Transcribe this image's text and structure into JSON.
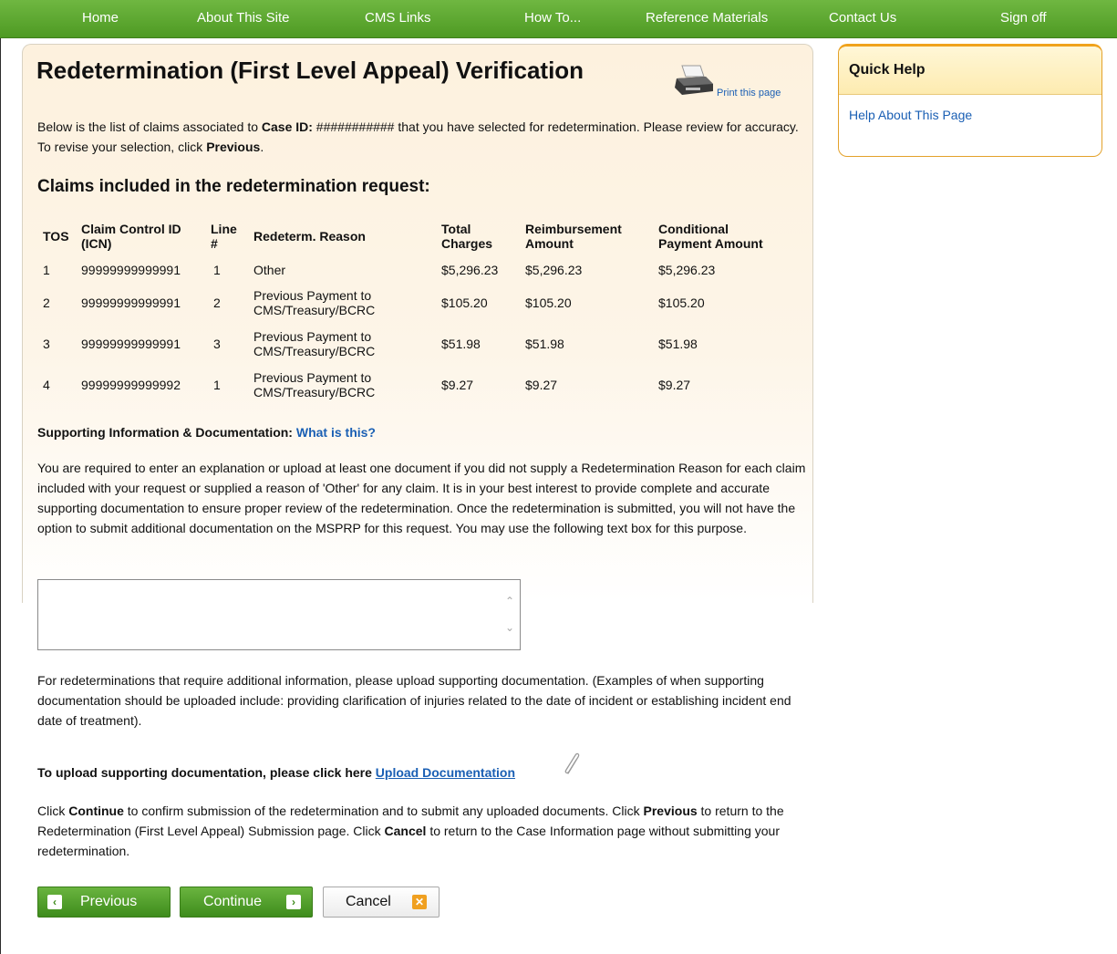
{
  "nav": {
    "items": [
      "Home",
      "About This Site",
      "CMS Links",
      "How To...",
      "Reference Materials",
      "Contact Us",
      "Sign off"
    ]
  },
  "page": {
    "title": "Redetermination (First Level Appeal) Verification",
    "print_link": "Print this page",
    "intro_before": "Below is the list of claims associated to ",
    "intro_case_label": "Case ID:",
    "intro_case_value": " ########### ",
    "intro_after": "that you have selected for redetermination. Please review for accuracy. To revise your selection, click ",
    "intro_previous": "Previous",
    "intro_end": "."
  },
  "claims": {
    "section_title": "Claims included in the redetermination request:",
    "headers": {
      "tos": "TOS",
      "icn_line1": "Claim Control ID",
      "icn_line2": "(ICN)",
      "line_line1": "Line",
      "line_line2": "#",
      "reason": "Redeterm. Reason",
      "total_line1": "Total",
      "total_line2": "Charges",
      "reimb_line1": "Reimbursement",
      "reimb_line2": "Amount",
      "cond_line1": "Conditional",
      "cond_line2": "Payment Amount"
    },
    "rows": [
      {
        "tos": "1",
        "icn": "99999999999991",
        "line": "1",
        "reason_1": "Other",
        "reason_2": "",
        "total": "$5,296.23",
        "reimb": "$5,296.23",
        "cond": "$5,296.23"
      },
      {
        "tos": "2",
        "icn": "99999999999991",
        "line": "2",
        "reason_1": "Previous Payment to",
        "reason_2": "CMS/Treasury/BCRC",
        "total": "$105.20",
        "reimb": "$105.20",
        "cond": "$105.20"
      },
      {
        "tos": "3",
        "icn": "99999999999991",
        "line": "3",
        "reason_1": "Previous Payment to",
        "reason_2": "CMS/Treasury/BCRC",
        "total": "$51.98",
        "reimb": "$51.98",
        "cond": "$51.98"
      },
      {
        "tos": "4",
        "icn": "99999999999992",
        "line": "1",
        "reason_1": "Previous Payment to",
        "reason_2": "CMS/Treasury/BCRC",
        "total": "$9.27",
        "reimb": "$9.27",
        "cond": "$9.27"
      }
    ]
  },
  "support": {
    "label": "Supporting Information & Documentation: ",
    "what_link": "What is this?",
    "required_text": "You are required to enter an explanation or upload at least one document if you did not supply a Redetermination Reason for each claim included with your request or supplied a reason of 'Other' for any claim. It is in your best interest to provide complete and accurate supporting documentation to ensure proper review of the redetermination. Once the redetermination is submitted, you will not have the option to submit additional documentation on the MSPRP for this request. You may use the following text box for this purpose.",
    "textarea_value": "",
    "upload_info": "For redeterminations that require additional information, please upload supporting documentation. (Examples of when supporting documentation should be uploaded include: providing clarification of injuries related to the date of incident or establishing incident end date of treatment).",
    "upload_prompt": "To upload supporting documentation, please click here ",
    "upload_link": "Upload Documentation"
  },
  "instructions": {
    "p1": "Click ",
    "continue_word": "Continue",
    "p2": " to confirm submission of the redetermination and to submit any uploaded documents. Click ",
    "previous_word": "Previous",
    "p3": " to return to the Redetermination (First Level Appeal) Submission page. Click ",
    "cancel_word": "Cancel",
    "p4": " to return to the Case Information page without submitting your redetermination."
  },
  "buttons": {
    "previous": "Previous",
    "continue": "Continue",
    "cancel": "Cancel"
  },
  "quick_help": {
    "title": "Quick Help",
    "link": "Help About This Page"
  },
  "colors": {
    "nav_green": "#4e9a23",
    "link_blue": "#1a5fb4",
    "quick_help_orange": "#f0a21c"
  }
}
